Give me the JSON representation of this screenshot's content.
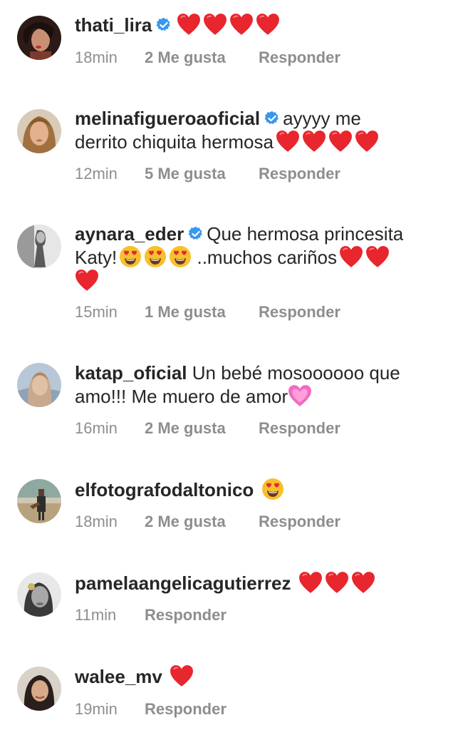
{
  "comments": [
    {
      "username": "thati_lira",
      "verified": true,
      "text": "",
      "time": "18min",
      "likes": "2 Me gusta",
      "reply": "Responder"
    },
    {
      "username": "melinafigueroaoficial",
      "verified": true,
      "text_line1": "ayyyy me",
      "text_line2": "derrito chiquita hermosa",
      "time": "12min",
      "likes": "5 Me gusta",
      "reply": "Responder"
    },
    {
      "username": "aynara_eder",
      "verified": true,
      "text_line1": "Que hermosa princesita",
      "text_line2a": "Katy!",
      "text_line2b": "..muchos cariños",
      "time": "15min",
      "likes": "1 Me gusta",
      "reply": "Responder"
    },
    {
      "username": "katap_oficial",
      "verified": false,
      "text_line1": "Un bebé mosoooooo que",
      "text_line2": "amo!!! Me muero de amor",
      "time": "16min",
      "likes": "2 Me gusta",
      "reply": "Responder"
    },
    {
      "username": "elfotografodaltonico",
      "verified": false,
      "text": "",
      "time": "18min",
      "likes": "2 Me gusta",
      "reply": "Responder"
    },
    {
      "username": "pamelaangelicagutierrez",
      "verified": false,
      "text": "",
      "time": "11min",
      "reply": "Responder"
    },
    {
      "username": "walee_mv",
      "verified": false,
      "text": "",
      "time": "19min",
      "reply": "Responder"
    }
  ],
  "icons": {
    "verified": "verified-badge-icon",
    "heart": "red-heart-emoji",
    "heart_eyes": "heart-eyes-emoji",
    "pink_heart": "sparkling-heart-emoji"
  },
  "colors": {
    "text": "#262626",
    "meta": "#8e8e8e",
    "verified": "#3897f0",
    "heart": "#e8262d"
  }
}
